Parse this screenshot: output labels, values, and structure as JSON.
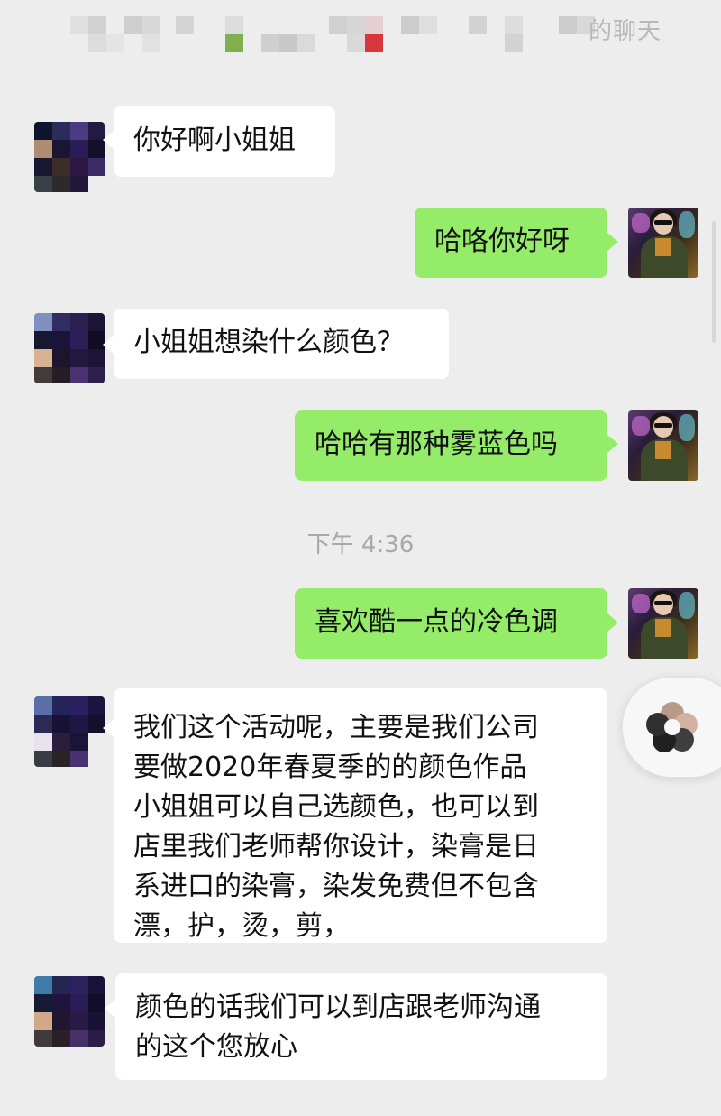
{
  "header": {
    "title": "的聊天"
  },
  "timestamp": "下午 4:36",
  "messages": [
    {
      "side": "left",
      "text": "你好啊小姐姐"
    },
    {
      "side": "right",
      "text": "哈咯你好呀"
    },
    {
      "side": "left",
      "text": "小姐姐想染什么颜色？"
    },
    {
      "side": "right",
      "text": "哈哈有那种雾蓝色吗"
    },
    {
      "side": "right",
      "text": "喜欢酷一点的冷色调"
    },
    {
      "side": "left",
      "text": "我们这个活动呢，主要是我们公司\n要做2020年春夏季的的颜色作品\n小姐姐可以自己选颜色，也可以到\n店里我们老师帮你设计，染膏是日\n系进口的染膏，染发免费但不包含\n漂，护，烫，剪，"
    },
    {
      "side": "left",
      "text": "颜色的话我们可以到店跟老师沟通\n的这个您放心"
    }
  ],
  "floating_button": {
    "icon": "flower-icon"
  },
  "colors": {
    "background": "#ededed",
    "self_bubble": "#95ec69",
    "other_bubble": "#ffffff"
  }
}
